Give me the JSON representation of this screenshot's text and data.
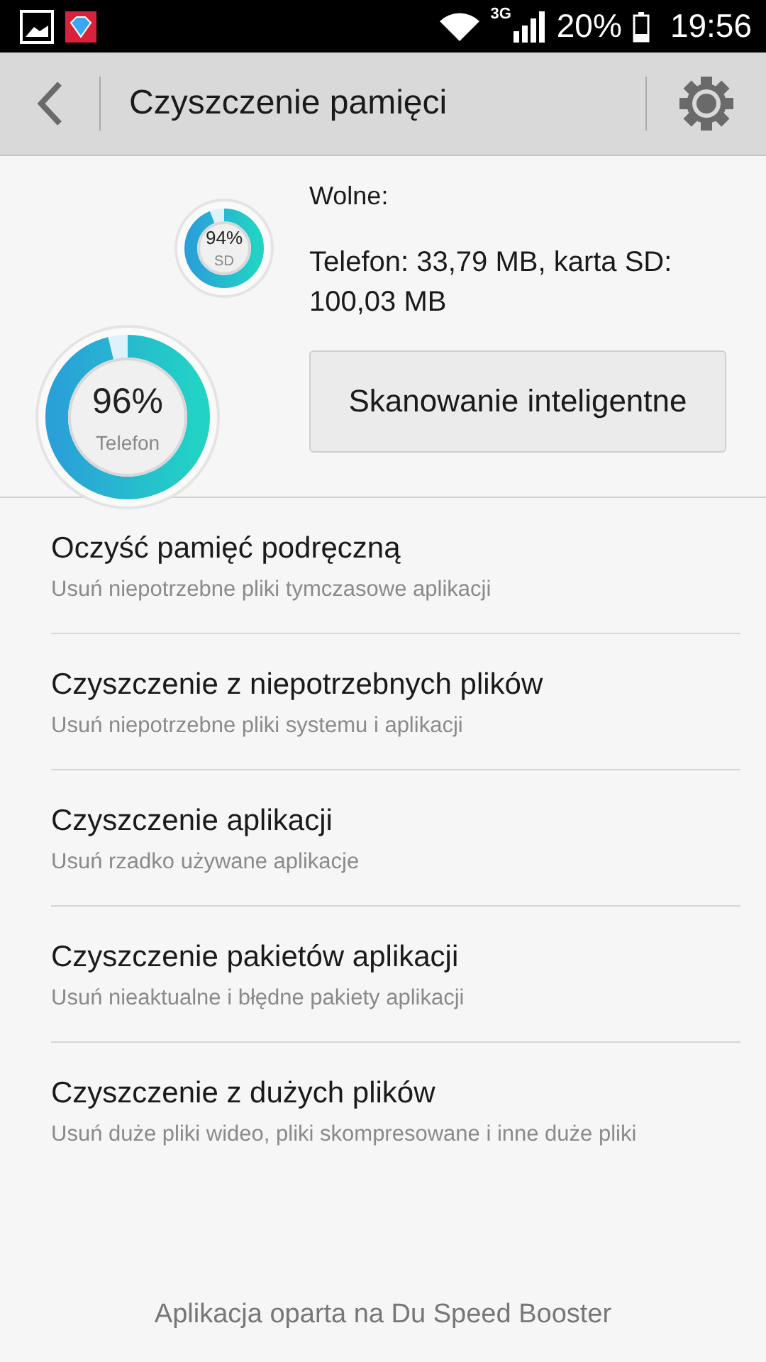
{
  "status_bar": {
    "network": "3G",
    "battery": "20%",
    "time": "19:56"
  },
  "toolbar": {
    "title": "Czyszczenie pamięci"
  },
  "gauges": [
    {
      "kind": "large",
      "value": "96%",
      "label": "Telefon",
      "level": 0.96
    },
    {
      "kind": "small",
      "value": "94%",
      "label": "SD",
      "level": 0.94
    }
  ],
  "free": {
    "label": "Wolne:",
    "details": "Telefon: 33,79 MB, karta SD: 100,03 MB"
  },
  "scan_button": "Skanowanie inteligentne",
  "items": [
    {
      "title": "Oczyść pamięć podręczną",
      "subtitle": "Usuń niepotrzebne pliki tymczasowe aplikacji"
    },
    {
      "title": "Czyszczenie z niepotrzebnych plików",
      "subtitle": "Usuń niepotrzebne pliki systemu i aplikacji"
    },
    {
      "title": "Czyszczenie aplikacji",
      "subtitle": "Usuń rzadko używane aplikacje"
    },
    {
      "title": "Czyszczenie pakietów aplikacji",
      "subtitle": "Usuń nieaktualne i błędne pakiety aplikacji"
    },
    {
      "title": "Czyszczenie z dużych plików",
      "subtitle": "Usuń duże pliki wideo, pliki skompresowane i inne duże pliki"
    }
  ],
  "footer": "Aplikacja oparta na Du Speed Booster"
}
